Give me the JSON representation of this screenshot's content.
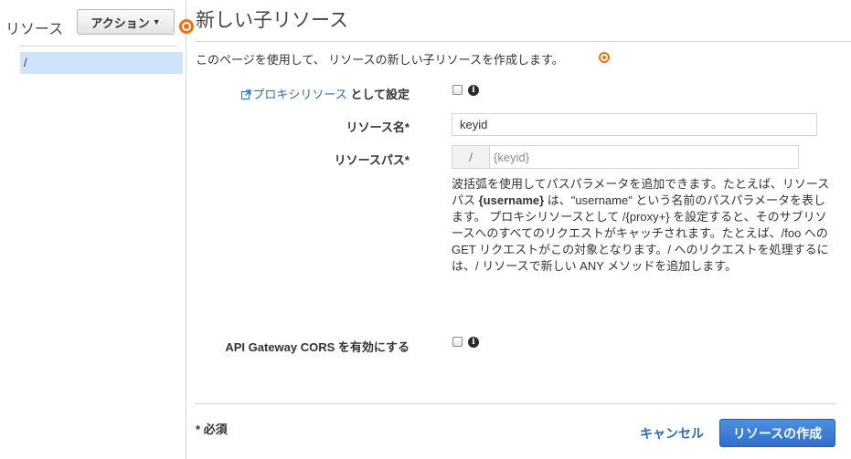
{
  "sidebar": {
    "title": "リソース",
    "actions_label": "アクション",
    "root_item": "/"
  },
  "main": {
    "title": "新しい子リソース",
    "intro": "このページを使用して、 リソースの新しい子リソースを作成します。"
  },
  "form": {
    "proxy": {
      "link_text": "プロキシリソース",
      "suffix": "として設定",
      "checked": false
    },
    "resource_name": {
      "label": "リソース名*",
      "value": "keyid"
    },
    "resource_path": {
      "label": "リソースパス*",
      "prefix": "/",
      "value": "{keyid}"
    },
    "help": {
      "segment1": "波括弧を使用してパスパラメータを追加できます。たとえば、リソースパス ",
      "bold": "{username}",
      "segment2": " は、\"username\" という名前のパスパラメータを表します。 プロキシリソースとして /{proxy+} を設定すると、そのサブリソースへのすべてのリクエストがキャッチされます。たとえば、/foo への GET リクエストがこの対象となります。/ へのリクエストを処理するには、/ リソースで新しい ANY メソッドを追加します。"
    },
    "cors": {
      "label": "API Gateway CORS を有効にする",
      "checked": false
    }
  },
  "footer": {
    "required_note": "* 必須",
    "cancel_label": "キャンセル",
    "create_label": "リソースの作成"
  },
  "colors": {
    "accent_orange": "#ec7211",
    "link_blue": "#2d6cb5",
    "primary_button": "#2e6fcd",
    "selected_row": "#cfe3fb"
  },
  "icons": [
    "caret-down-icon",
    "help-info-icon",
    "external-link-icon",
    "info-icon"
  ]
}
